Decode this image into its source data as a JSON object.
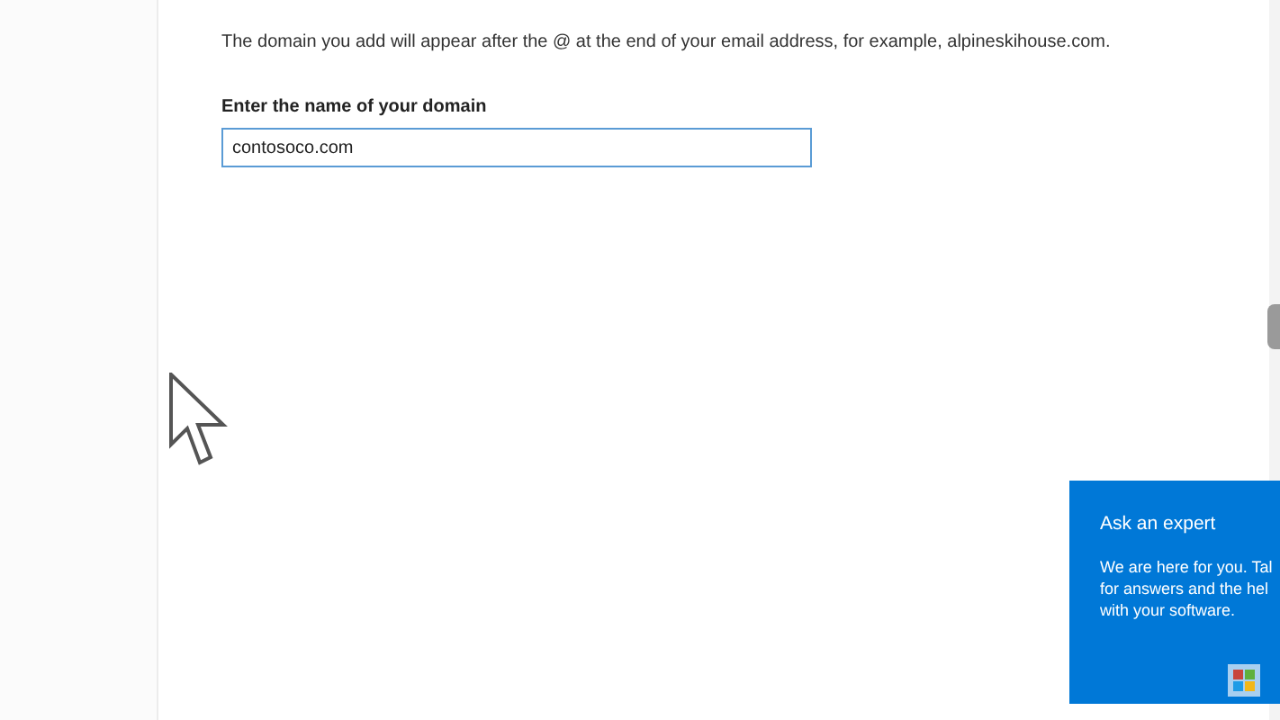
{
  "intro": "The domain you add will appear after the @ at the end of your email address, for example, alpineskihouse.com.",
  "domain_field": {
    "label": "Enter the name of your domain",
    "value": "contosoco.com"
  },
  "expert_panel": {
    "title": "Ask an expert",
    "lines": [
      "We are here for you. Tal",
      "for answers and the hel",
      "with your software."
    ]
  }
}
